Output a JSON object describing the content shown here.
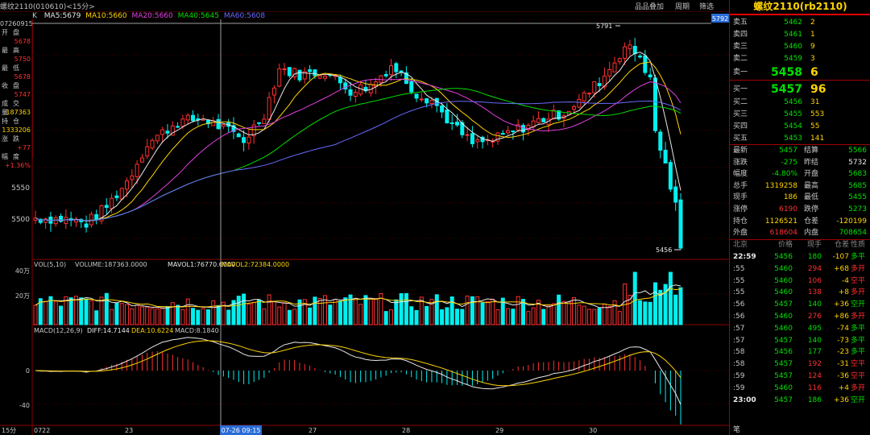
{
  "window": {
    "title": "螺纹2110(010610)<15分>",
    "buttons": [
      "品品叠加",
      "周期",
      "筛选"
    ]
  },
  "ma_line": [
    {
      "text": "K",
      "color": "#c8c8c8"
    },
    {
      "text": "MA5:5679",
      "color": "#e8e8e8"
    },
    {
      "text": "MA10:5660",
      "color": "#ffd400"
    },
    {
      "text": "MA20:5660",
      "color": "#e040e0"
    },
    {
      "text": "MA40:5645",
      "color": "#00e000"
    },
    {
      "text": "MA60:5608",
      "color": "#6a6aff"
    }
  ],
  "left_info": {
    "time": "07260915",
    "rows": [
      {
        "label": "开盘",
        "value": "5678",
        "color": "#ff3030"
      },
      {
        "label": "最高",
        "value": "5750",
        "color": "#ff3030"
      },
      {
        "label": "最低",
        "value": "5678",
        "color": "#ff3030"
      },
      {
        "label": "收盘",
        "value": "5747",
        "color": "#ff3030"
      },
      {
        "label": "成交量",
        "value": "187363",
        "color": "#ffd400"
      },
      {
        "label": "持仓",
        "value": "1333206",
        "color": "#ffd400"
      },
      {
        "label": "涨跌",
        "value": "+77",
        "color": "#ff3030"
      },
      {
        "label": "幅度",
        "value": "+1.36%",
        "color": "#ff3030"
      }
    ]
  },
  "price_axis": {
    "ticks": [
      "5550",
      "5500"
    ],
    "top_marker": "5792"
  },
  "annotations": {
    "high": "5791",
    "low": "5456",
    "crosshair_time": "07-26 09:15"
  },
  "vol_panel": {
    "legend": [
      {
        "text": "VOL(5,10)",
        "color": "#c8c8c8"
      },
      {
        "text": "VOLUME:187363.0000",
        "color": "#c8c8c8"
      },
      {
        "text": "MAVOL1:76770.6000",
        "color": "#e8e8e8"
      },
      {
        "text": "MAVOL2:72384.0000",
        "color": "#ffd400"
      }
    ],
    "ticks": [
      "40万",
      "20万"
    ]
  },
  "macd_panel": {
    "legend": [
      {
        "text": "MACD(12,26,9)",
        "color": "#c8c8c8"
      },
      {
        "text": "DIFF:14.7144",
        "color": "#e8e8e8"
      },
      {
        "text": "DEA:10.6224",
        "color": "#ffd400"
      },
      {
        "text": "MACD:8.1840",
        "color": "#c8c8c8"
      }
    ],
    "ticks": [
      "0",
      "-40"
    ]
  },
  "x_axis": {
    "period": "15分",
    "labels": [
      "0722",
      "23",
      "27",
      "28",
      "29",
      "30"
    ]
  },
  "right_panel": {
    "symbol": "螺纹2110(rb2110)",
    "asks": [
      {
        "label": "卖五",
        "price": "5462",
        "vol": "2"
      },
      {
        "label": "卖四",
        "price": "5461",
        "vol": "1"
      },
      {
        "label": "卖三",
        "price": "5460",
        "vol": "9"
      },
      {
        "label": "卖二",
        "price": "5459",
        "vol": "3"
      },
      {
        "label": "卖一",
        "price": "5458",
        "vol": "6"
      }
    ],
    "bids": [
      {
        "label": "买一",
        "price": "5457",
        "vol": "96"
      },
      {
        "label": "买二",
        "price": "5456",
        "vol": "31"
      },
      {
        "label": "买三",
        "price": "5455",
        "vol": "553"
      },
      {
        "label": "买四",
        "price": "5454",
        "vol": "55"
      },
      {
        "label": "买五",
        "price": "5453",
        "vol": "141"
      }
    ],
    "stats": [
      {
        "l1": "最新",
        "v1": "5457",
        "c1": "#00e000",
        "l2": "结算",
        "v2": "5566",
        "c2": "#00e000"
      },
      {
        "l1": "涨跌",
        "v1": "-275",
        "c1": "#00e000",
        "l2": "昨结",
        "v2": "5732",
        "c2": "#e8e8e8"
      },
      {
        "l1": "幅度",
        "v1": "-4.80%",
        "c1": "#00e000",
        "l2": "开盘",
        "v2": "5683",
        "c2": "#00e000"
      },
      {
        "l1": "总手",
        "v1": "1319258",
        "c1": "#ffd400",
        "l2": "最高",
        "v2": "5685",
        "c2": "#00e000"
      },
      {
        "l1": "现手",
        "v1": "186",
        "c1": "#ffd400",
        "l2": "最低",
        "v2": "5455",
        "c2": "#00e000"
      },
      {
        "l1": "涨停",
        "v1": "6190",
        "c1": "#ff3030",
        "l2": "跌停",
        "v2": "5273",
        "c2": "#00e000"
      },
      {
        "l1": "持仓",
        "v1": "1126521",
        "c1": "#ffd400",
        "l2": "仓差",
        "v2": "-120199",
        "c2": "#ffd400"
      },
      {
        "l1": "外盘",
        "v1": "618604",
        "c1": "#ff3030",
        "l2": "内盘",
        "v2": "708654",
        "c2": "#00e000"
      }
    ],
    "tick_header": [
      "北京",
      "价格",
      "现手",
      "仓差",
      "性质"
    ],
    "ticks": [
      {
        "t": "22:59",
        "p": "5456",
        "pc": "#00e000",
        "v": "180",
        "vc": "#00e000",
        "d": "-107",
        "dc": "#ffd400",
        "k": "多平",
        "kc": "#00e000"
      },
      {
        "t": ":55",
        "p": "5460",
        "pc": "#00e000",
        "v": "294",
        "vc": "#ff3030",
        "d": "+68",
        "dc": "#ffd400",
        "k": "多开",
        "kc": "#ff3030"
      },
      {
        "t": ":55",
        "p": "5460",
        "pc": "#00e000",
        "v": "106",
        "vc": "#ff3030",
        "d": "-4",
        "dc": "#ffd400",
        "k": "空平",
        "kc": "#ff3030"
      },
      {
        "t": ":55",
        "p": "5460",
        "pc": "#00e000",
        "v": "138",
        "vc": "#ff3030",
        "d": "+8",
        "dc": "#ffd400",
        "k": "多开",
        "kc": "#ff3030"
      },
      {
        "t": ":56",
        "p": "5457",
        "pc": "#00e000",
        "v": "140",
        "vc": "#00e000",
        "d": "+36",
        "dc": "#ffd400",
        "k": "空开",
        "kc": "#00e000"
      },
      {
        "t": ":56",
        "p": "5460",
        "pc": "#00e000",
        "v": "276",
        "vc": "#ff3030",
        "d": "+86",
        "dc": "#ffd400",
        "k": "多开",
        "kc": "#ff3030"
      },
      {
        "t": ":57",
        "p": "5460",
        "pc": "#00e000",
        "v": "495",
        "vc": "#00e000",
        "d": "-74",
        "dc": "#ffd400",
        "k": "多平",
        "kc": "#00e000"
      },
      {
        "t": ":57",
        "p": "5457",
        "pc": "#00e000",
        "v": "140",
        "vc": "#00e000",
        "d": "-73",
        "dc": "#ffd400",
        "k": "多平",
        "kc": "#00e000"
      },
      {
        "t": ":58",
        "p": "5456",
        "pc": "#00e000",
        "v": "177",
        "vc": "#00e000",
        "d": "-23",
        "dc": "#ffd400",
        "k": "多平",
        "kc": "#00e000"
      },
      {
        "t": ":58",
        "p": "5457",
        "pc": "#00e000",
        "v": "192",
        "vc": "#ff3030",
        "d": "-31",
        "dc": "#ffd400",
        "k": "空平",
        "kc": "#ff3030"
      },
      {
        "t": ":59",
        "p": "5457",
        "pc": "#00e000",
        "v": "124",
        "vc": "#ff3030",
        "d": "-36",
        "dc": "#ffd400",
        "k": "空平",
        "kc": "#ff3030"
      },
      {
        "t": ":59",
        "p": "5460",
        "pc": "#00e000",
        "v": "116",
        "vc": "#ff3030",
        "d": "+4",
        "dc": "#ffd400",
        "k": "多开",
        "kc": "#ff3030"
      },
      {
        "t": "23:00",
        "p": "5457",
        "pc": "#00e000",
        "v": "186",
        "vc": "#00e000",
        "d": "+36",
        "dc": "#ffd400",
        "k": "空开",
        "kc": "#00e000"
      }
    ],
    "footer": "笔"
  },
  "chart_data": {
    "type": "candlestick",
    "interval": "15分",
    "ylim": [
      5440,
      5800
    ],
    "x_labels": [
      "0722",
      "23",
      "27",
      "28",
      "29",
      "30"
    ],
    "last_close": 5456,
    "high": 5791,
    "low": 5456
  }
}
